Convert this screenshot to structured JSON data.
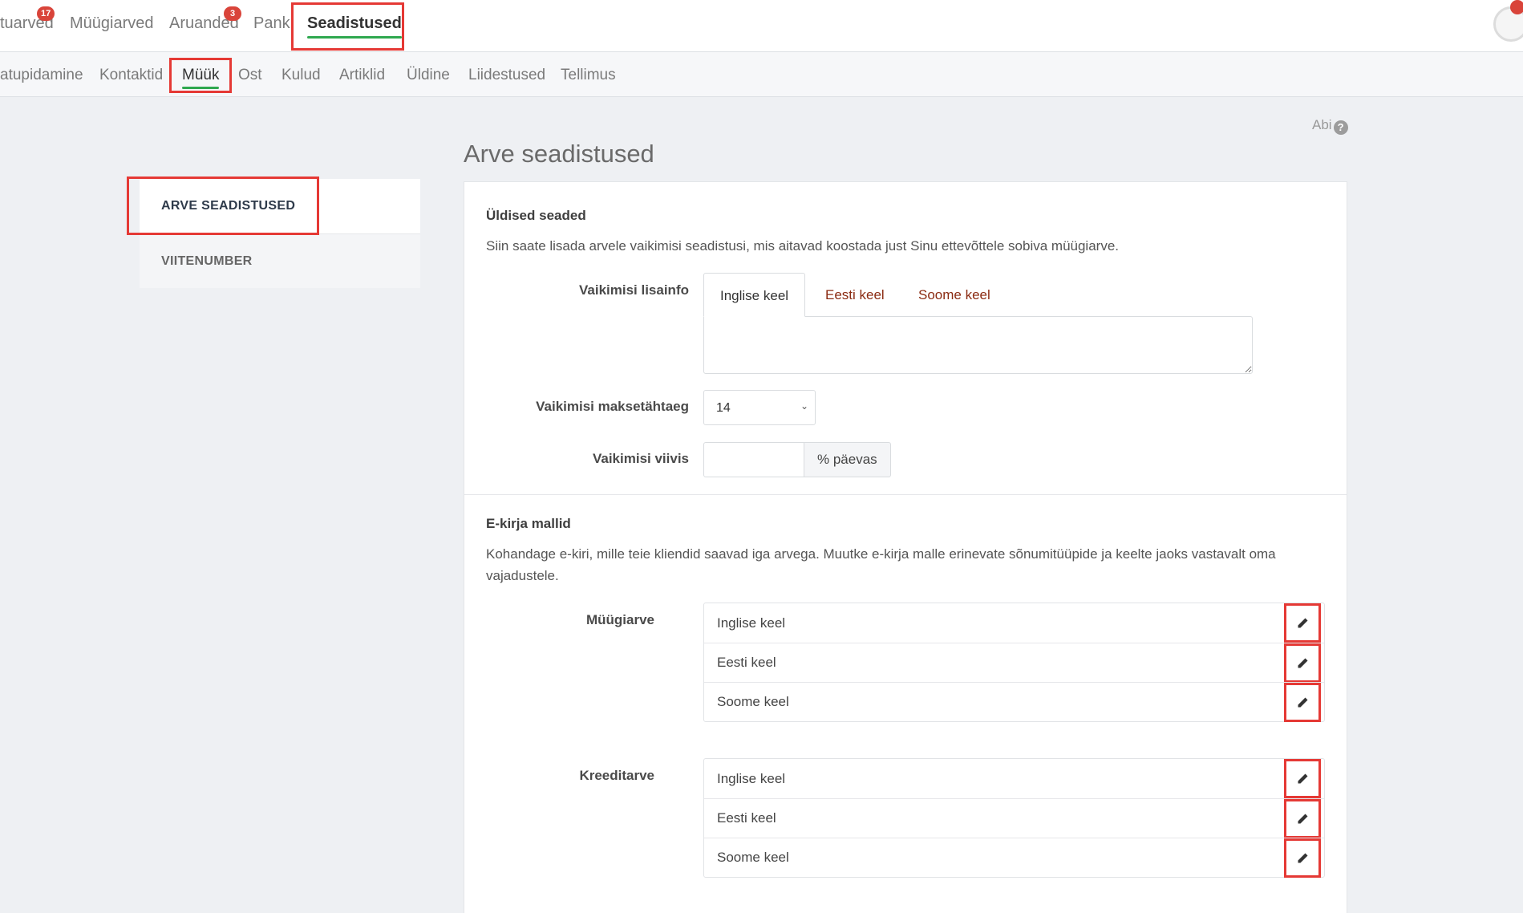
{
  "topnav": {
    "items": [
      {
        "label": "tuarved",
        "badge": "17"
      },
      {
        "label": "Müügiarved"
      },
      {
        "label": "Aruanded",
        "badge": "3"
      },
      {
        "label": "Pank"
      },
      {
        "label": "Seadistused"
      }
    ]
  },
  "subnav": {
    "items": [
      "atupidamine",
      "Kontaktid",
      "Müük",
      "Ost",
      "Kulud",
      "Artiklid",
      "Üldine",
      "Liidestused",
      "Tellimus"
    ]
  },
  "help": {
    "label": "Abi",
    "icon": "?"
  },
  "page_title": "Arve seadistused",
  "side_menu": {
    "items": [
      "ARVE SEADISTUSED",
      "VIITENUMBER"
    ]
  },
  "general": {
    "title": "Üldised seaded",
    "description": "Siin saate lisada arvele vaikimisi seadistusi, mis aitavad koostada just Sinu ettevõttele sobiva müügiarve.",
    "info_label": "Vaikimisi lisainfo",
    "tabs": [
      "Inglise keel",
      "Eesti keel",
      "Soome keel"
    ],
    "due_label": "Vaikimisi maksetähtaeg",
    "due_value": "14",
    "penalty_label": "Vaikimisi viivis",
    "penalty_addon": "% päevas"
  },
  "email": {
    "title": "E-kirja mallid",
    "description": "Kohandage e-kiri, mille teie kliendid saavad iga arvega. Muutke e-kirja malle erinevate sõnumitüüpide ja keelte jaoks vastavalt oma vajadustele.",
    "groups": [
      {
        "label": "Müügiarve",
        "rows": [
          "Inglise keel",
          "Eesti keel",
          "Soome keel"
        ]
      },
      {
        "label": "Kreeditarve",
        "rows": [
          "Inglise keel",
          "Eesti keel",
          "Soome keel"
        ]
      }
    ]
  },
  "colors": {
    "accent": "#2fa84f",
    "highlight": "#e53935",
    "badge": "#d9443a",
    "tab_link": "#8b2b12"
  }
}
